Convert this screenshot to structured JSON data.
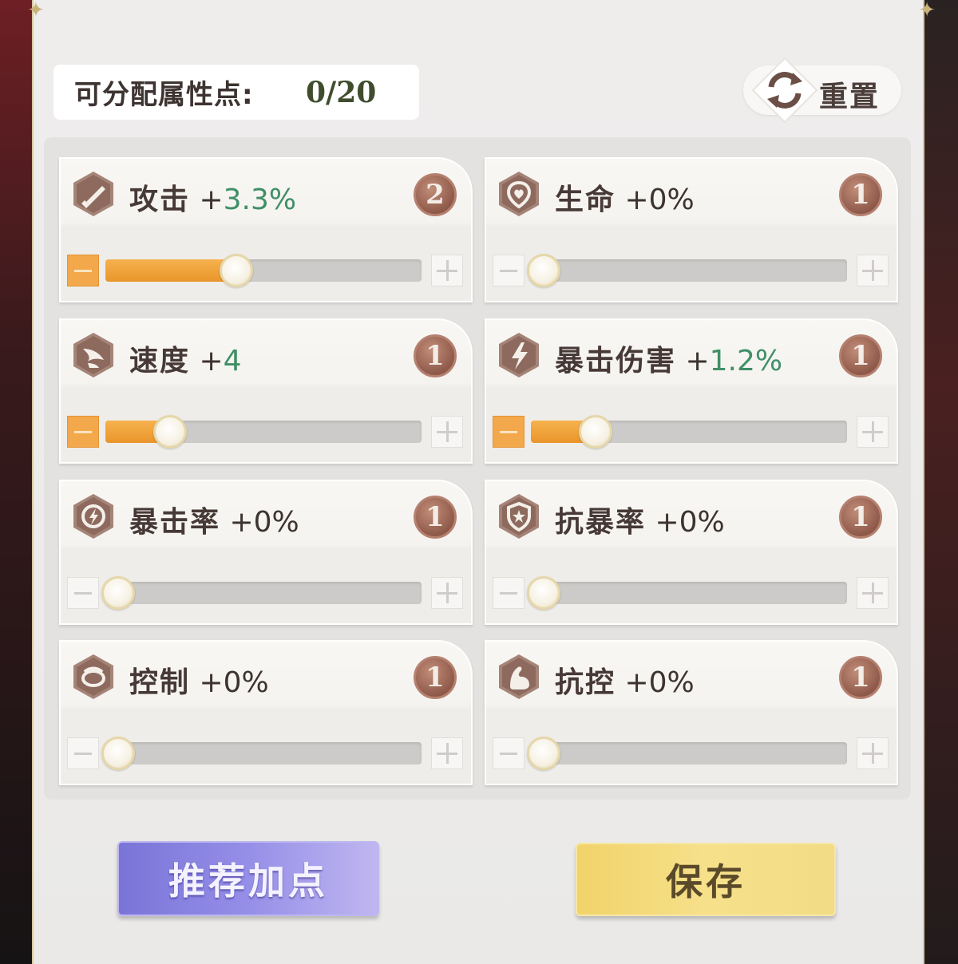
{
  "header": {
    "points_label": "可分配属性点:",
    "points_value": "0/20",
    "reset_label": "重置"
  },
  "stats": [
    {
      "name": "攻击",
      "plus": "+",
      "value": "3.3%",
      "highlight": true,
      "cost": "2",
      "minus_active": true,
      "level": 0.39,
      "icon": "sword-icon"
    },
    {
      "name": "生命",
      "plus": "+",
      "value": "0%",
      "highlight": false,
      "cost": "1",
      "minus_active": false,
      "level": 0,
      "icon": "heart-shield-icon"
    },
    {
      "name": "速度",
      "plus": "+",
      "value": "4",
      "highlight": true,
      "cost": "1",
      "minus_active": true,
      "level": 0.17,
      "icon": "wing-icon"
    },
    {
      "name": "暴击伤害",
      "plus": "+",
      "value": "1.2%",
      "highlight": true,
      "cost": "1",
      "minus_active": true,
      "level": 0.17,
      "icon": "lightning-icon"
    },
    {
      "name": "暴击率",
      "plus": "+",
      "value": "0%",
      "highlight": false,
      "cost": "1",
      "minus_active": false,
      "level": 0,
      "icon": "lightning-circle-icon"
    },
    {
      "name": "抗暴率",
      "plus": "+",
      "value": "0%",
      "highlight": false,
      "cost": "1",
      "minus_active": false,
      "level": 0,
      "icon": "shield-star-icon"
    },
    {
      "name": "控制",
      "plus": "+",
      "value": "0%",
      "highlight": false,
      "cost": "1",
      "minus_active": false,
      "level": 0,
      "icon": "coil-icon"
    },
    {
      "name": "抗控",
      "plus": "+",
      "value": "0%",
      "highlight": false,
      "cost": "1",
      "minus_active": false,
      "level": 0,
      "icon": "muscle-icon"
    }
  ],
  "buttons": {
    "recommend_label": "推荐加点",
    "save_label": "保存"
  }
}
